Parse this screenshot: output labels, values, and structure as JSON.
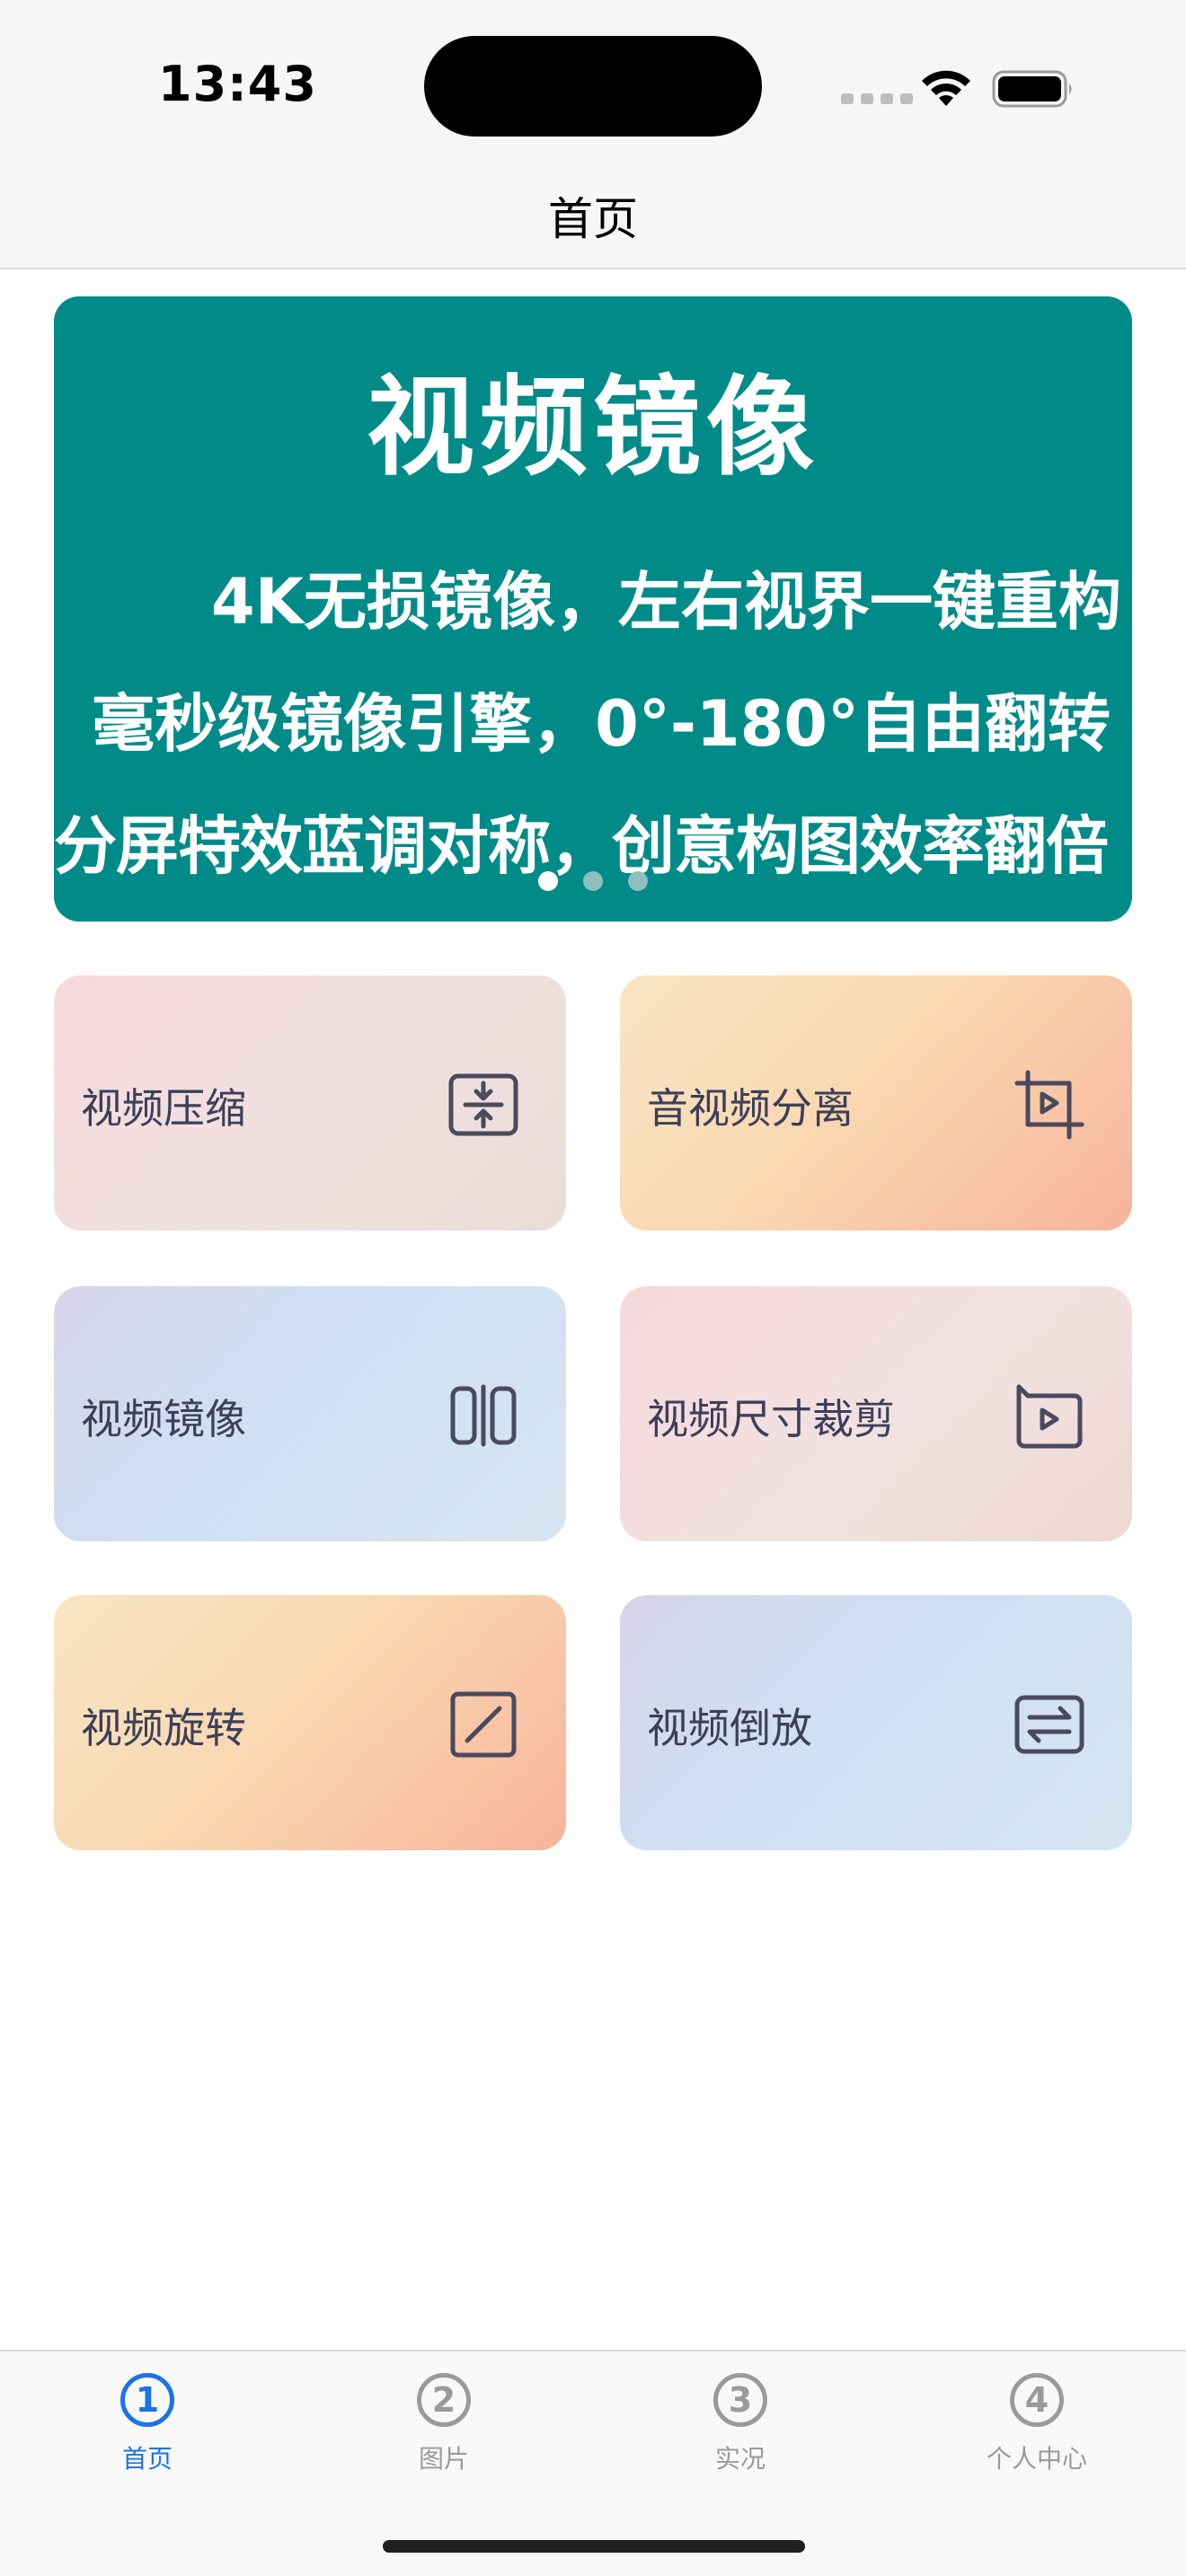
{
  "status_bar": {
    "time": "13:43"
  },
  "nav": {
    "title": "首页"
  },
  "banner": {
    "title": "视频镜像",
    "lines": [
      "4K无损镜像，左右视界一键重构",
      "毫秒级镜像引擎，0°-180°自由翻转",
      "分屏特效蓝调对称，创意构图效率翻倍"
    ],
    "background": "#008b89",
    "page_count": 3,
    "active_page": 1
  },
  "tiles": [
    {
      "label": "视频压缩",
      "icon": "compress-icon"
    },
    {
      "label": "音视频分离",
      "icon": "crop-play-icon"
    },
    {
      "label": "视频镜像",
      "icon": "mirror-icon"
    },
    {
      "label": "视频尺寸裁剪",
      "icon": "rotate-play-icon"
    },
    {
      "label": "视频旋转",
      "icon": "slash-square-icon"
    },
    {
      "label": "视频倒放",
      "icon": "reverse-arrows-icon"
    }
  ],
  "tab_bar": {
    "tabs": [
      {
        "num": "1",
        "label": "首页",
        "active": true
      },
      {
        "num": "2",
        "label": "图片",
        "active": false
      },
      {
        "num": "3",
        "label": "实况",
        "active": false
      },
      {
        "num": "4",
        "label": "个人中心",
        "active": false
      }
    ],
    "active_color": "#1a73e8",
    "inactive_color": "#9a9a9a"
  }
}
